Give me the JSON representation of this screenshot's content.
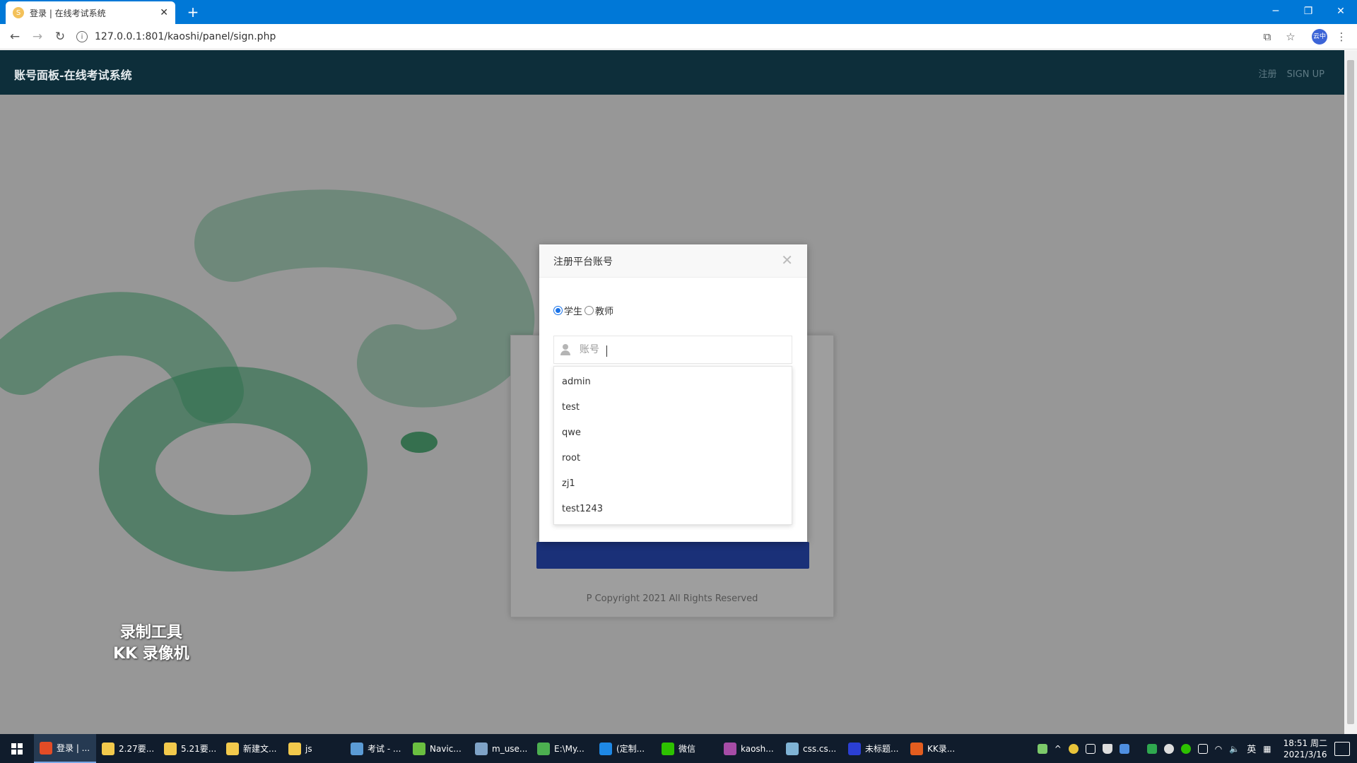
{
  "browser": {
    "tab_title": "登录 | 在线考试系统",
    "tab_favicon": "S",
    "url": "127.0.0.1:801/kaoshi/panel/sign.php",
    "profile_badge": "云中"
  },
  "appnav": {
    "brand": "账号面板-在线考试系统",
    "link_register_cn": "注册",
    "link_register_en": "SIGN UP"
  },
  "login_card": {
    "copyright": "P Copyright 2021 All Rights Reserved"
  },
  "modal": {
    "title": "注册平台账号",
    "role_student": "学生",
    "role_teacher": "教师",
    "selected_role": "学生",
    "account_placeholder": "账号",
    "suggestions": [
      "admin",
      "test",
      "qwe",
      "root",
      "zj1",
      "test1243"
    ]
  },
  "watermark": {
    "line1": "录制工具",
    "line2": "KK 录像机"
  },
  "taskbar": {
    "items": [
      {
        "label": "登录 | ...",
        "color": "#e34c26",
        "active": true
      },
      {
        "label": "2.27要...",
        "color": "#f2c94c",
        "active": false
      },
      {
        "label": "5.21要...",
        "color": "#f2c94c",
        "active": false
      },
      {
        "label": "新建文...",
        "color": "#f2c94c",
        "active": false
      },
      {
        "label": "js",
        "color": "#f2c94c",
        "active": false
      },
      {
        "label": "考试 - ...",
        "color": "#5b9bd5",
        "active": false
      },
      {
        "label": "Navic...",
        "color": "#6abf40",
        "active": false
      },
      {
        "label": "m_use...",
        "color": "#7fa3c7",
        "active": false
      },
      {
        "label": "E:\\My...",
        "color": "#4caf50",
        "active": false
      },
      {
        "label": "(定制...",
        "color": "#1e88e5",
        "active": false
      },
      {
        "label": "微信",
        "color": "#2dc100",
        "active": false
      },
      {
        "label": "kaosh...",
        "color": "#a64ca6",
        "active": false
      },
      {
        "label": "css.cs...",
        "color": "#7fb3d5",
        "active": false
      },
      {
        "label": "未标题...",
        "color": "#2b3fd3",
        "active": false
      },
      {
        "label": "KK录...",
        "color": "#e35d1f",
        "active": false
      }
    ],
    "ime": "英",
    "time": "18:51 周二",
    "date": "2021/3/16"
  }
}
